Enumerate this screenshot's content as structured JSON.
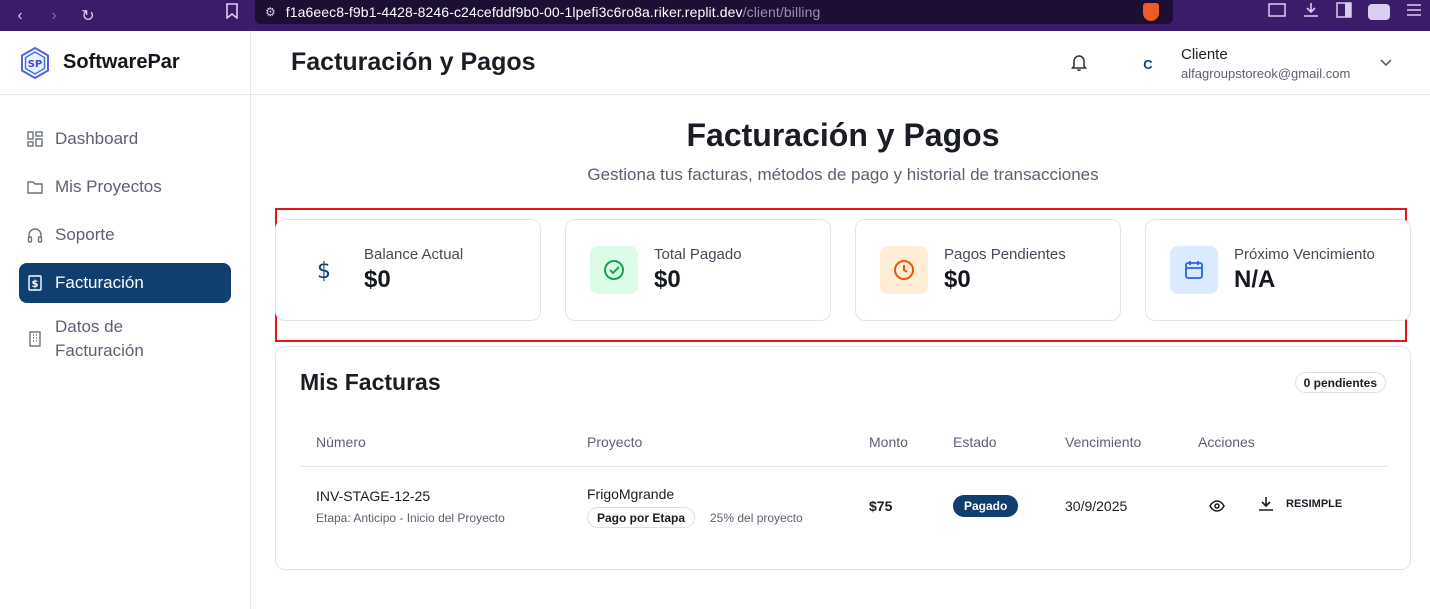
{
  "browser": {
    "url_main": "f1a6eec8-f9b1-4428-8246-c24cefddf9b0-00-1lpefi3c6ro8a.riker.replit.dev",
    "url_path": "/client/billing"
  },
  "brand": {
    "name": "SoftwarePar"
  },
  "sidebar": {
    "items": [
      {
        "label": "Dashboard",
        "icon": "dashboard-icon"
      },
      {
        "label": "Mis Proyectos",
        "icon": "folder-icon"
      },
      {
        "label": "Soporte",
        "icon": "headphones-icon"
      },
      {
        "label": "Facturación",
        "icon": "receipt-icon",
        "active": true
      },
      {
        "label": "Datos de Facturación",
        "icon": "building-icon"
      }
    ]
  },
  "header": {
    "title": "Facturación y Pagos",
    "avatar_initial": "C",
    "user_name": "Cliente",
    "user_email": "alfagroupstoreok@gmail.com"
  },
  "main": {
    "title": "Facturación y Pagos",
    "subtitle": "Gestiona tus facturas, métodos de pago y historial de transacciones"
  },
  "stats": [
    {
      "label": "Balance Actual",
      "value": "$0",
      "icon": "dollar-icon",
      "color": "#103f6f",
      "bg": "#ffffff"
    },
    {
      "label": "Total Pagado",
      "value": "$0",
      "icon": "check-circle-icon",
      "color": "#16a34a",
      "bg": "#dcfce7"
    },
    {
      "label": "Pagos Pendientes",
      "value": "$0",
      "icon": "clock-icon",
      "color": "#ea580c",
      "bg": "#ffedd5"
    },
    {
      "label": "Próximo Vencimiento",
      "value": "N/A",
      "icon": "calendar-icon",
      "color": "#2563eb",
      "bg": "#dbeafe"
    }
  ],
  "invoices": {
    "title": "Mis Facturas",
    "pending_badge": "0 pendientes",
    "columns": [
      "Número",
      "Proyecto",
      "Monto",
      "Estado",
      "Vencimiento",
      "Acciones"
    ],
    "rows": [
      {
        "number": "INV-STAGE-12-25",
        "stage": "Etapa: Anticipo - Inicio del Proyecto",
        "project": "FrigoMgrande",
        "project_tag": "Pago por Etapa",
        "project_pct": "25% del proyecto",
        "amount": "$75",
        "status": "Pagado",
        "due": "30/9/2025",
        "download_label": "RESIMPLE"
      }
    ]
  },
  "colors": {
    "accent": "#103f6f",
    "highlight": "#e3141b"
  }
}
